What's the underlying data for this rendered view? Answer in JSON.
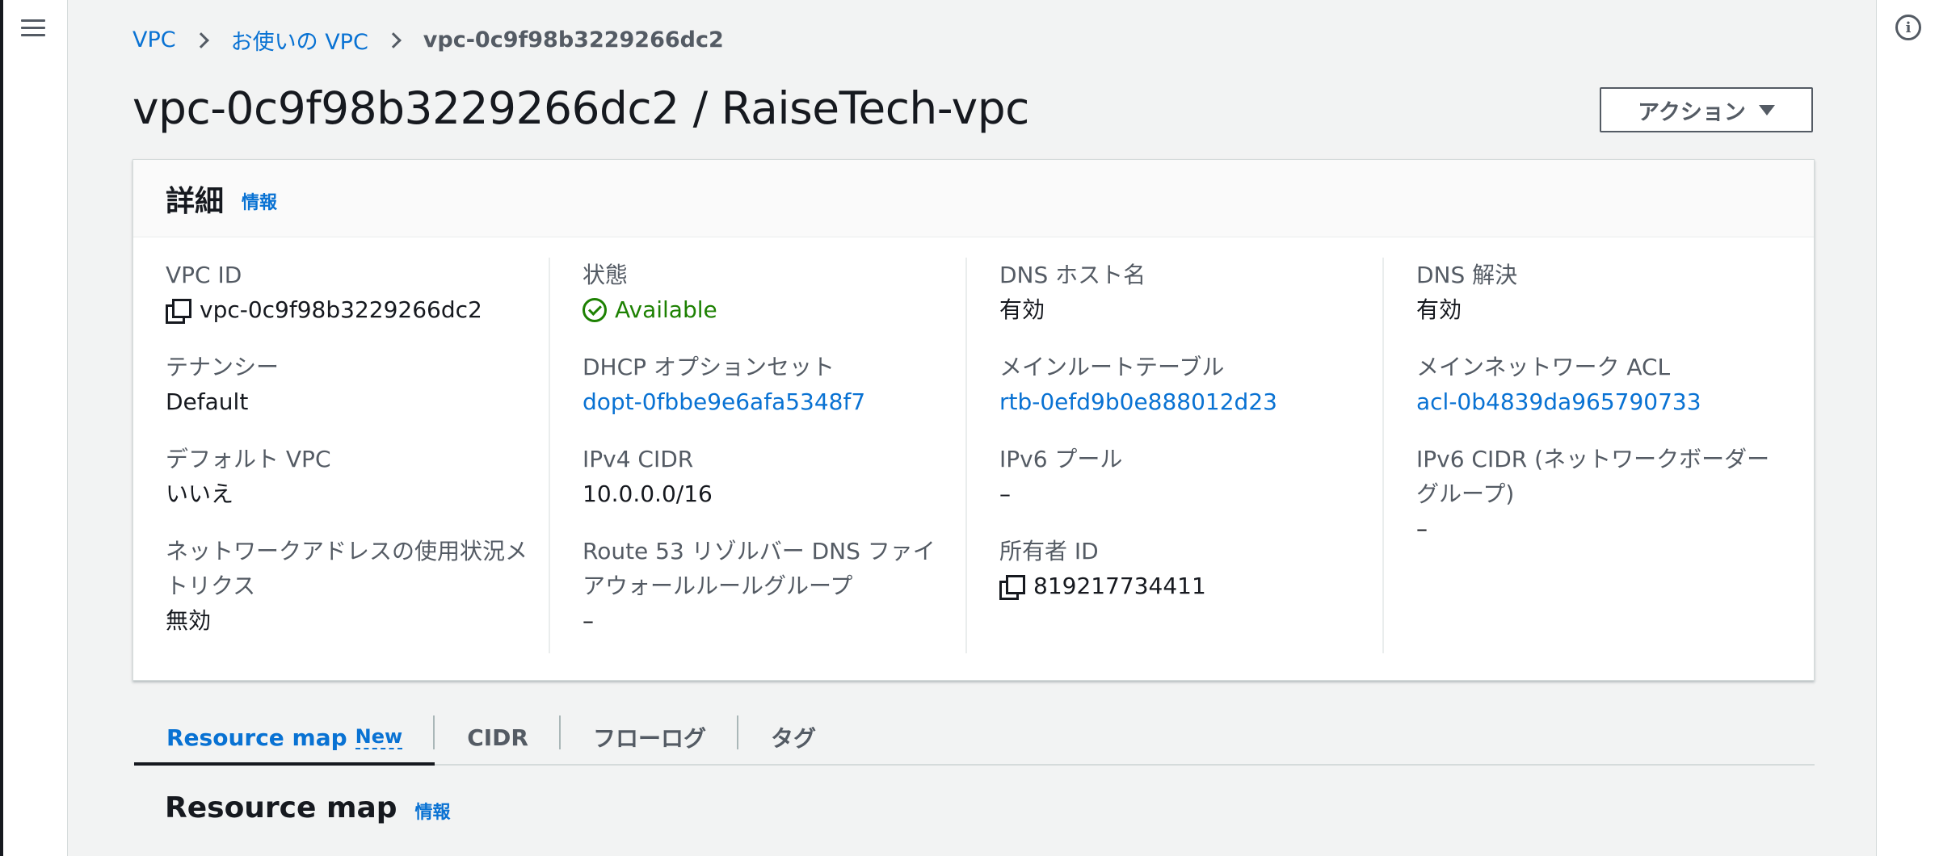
{
  "breadcrumb": {
    "items": [
      "VPC",
      "お使いの VPC"
    ],
    "current": "vpc-0c9f98b3229266dc2"
  },
  "page": {
    "title": "vpc-0c9f98b3229266dc2 / RaiseTech-vpc",
    "actions_label": "アクション"
  },
  "details": {
    "title": "詳細",
    "info_label": "情報",
    "columns": [
      [
        {
          "label": "VPC ID",
          "value": "vpc-0c9f98b3229266dc2",
          "kind": "copy"
        },
        {
          "label": "テナンシー",
          "value": "Default",
          "kind": "text"
        },
        {
          "label": "デフォルト VPC",
          "value": "いいえ",
          "kind": "text"
        },
        {
          "label": "ネットワークアドレスの使用状況メトリクス",
          "value": "無効",
          "kind": "text"
        }
      ],
      [
        {
          "label": "状態",
          "value": "Available",
          "kind": "status"
        },
        {
          "label": "DHCP オプションセット",
          "value": "dopt-0fbbe9e6afa5348f7",
          "kind": "link"
        },
        {
          "label": "IPv4 CIDR",
          "value": "10.0.0.0/16",
          "kind": "text"
        },
        {
          "label": "Route 53 リゾルバー DNS ファイアウォールルールグループ",
          "value": "–",
          "kind": "text"
        }
      ],
      [
        {
          "label": "DNS ホスト名",
          "value": "有効",
          "kind": "text"
        },
        {
          "label": "メインルートテーブル",
          "value": "rtb-0efd9b0e888012d23",
          "kind": "link"
        },
        {
          "label": "IPv6 プール",
          "value": "–",
          "kind": "text"
        },
        {
          "label": "所有者 ID",
          "value": "819217734411",
          "kind": "copy"
        }
      ],
      [
        {
          "label": "DNS 解決",
          "value": "有効",
          "kind": "text"
        },
        {
          "label": "メインネットワーク ACL",
          "value": "acl-0b4839da965790733",
          "kind": "link"
        },
        {
          "label": "IPv6 CIDR (ネットワークボーダーグループ)",
          "value": "–",
          "kind": "text"
        }
      ]
    ]
  },
  "tabs": {
    "items": [
      "Resource map",
      "CIDR",
      "フローログ",
      "タグ"
    ],
    "new_badge": "New"
  },
  "section": {
    "title": "Resource map",
    "info_label": "情報"
  },
  "colors": {
    "link": "#0972d3",
    "success": "#1d8102",
    "text": "#16191f",
    "muted": "#545b64"
  }
}
